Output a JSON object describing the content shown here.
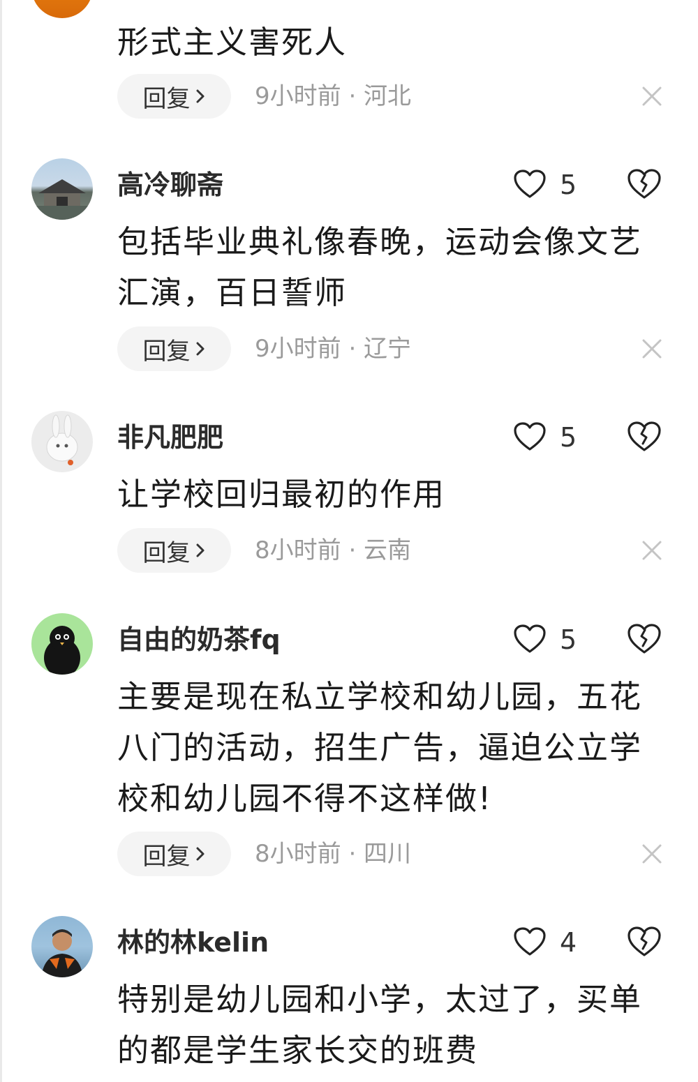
{
  "comments": [
    {
      "username": "",
      "likes": "",
      "text": "形式主义害死人",
      "reply_label": "回复",
      "time": "9小时前",
      "location": "河北",
      "meta": "9小时前 · 河北"
    },
    {
      "username": "高冷聊斋",
      "likes": "5",
      "text": "包括毕业典礼像春晚，运动会像文艺汇演，百日誓师",
      "reply_label": "回复",
      "time": "9小时前",
      "location": "辽宁",
      "meta": "9小时前 · 辽宁"
    },
    {
      "username": "非凡肥肥",
      "likes": "5",
      "text": "让学校回归最初的作用",
      "reply_label": "回复",
      "time": "8小时前",
      "location": "云南",
      "meta": "8小时前 · 云南"
    },
    {
      "username": "自由的奶茶fq",
      "likes": "5",
      "text": "主要是现在私立学校和幼儿园，五花八门的活动，招生广告，逼迫公立学校和幼儿园不得不这样做!",
      "reply_label": "回复",
      "time": "8小时前",
      "location": "四川",
      "meta": "8小时前 · 四川"
    },
    {
      "username": "林的林kelin",
      "likes": "4",
      "text": "特别是幼儿园和小学，太过了，买单的都是学生家长交的班费",
      "reply_label": "",
      "time": "",
      "location": "",
      "meta": ""
    }
  ],
  "icons": {
    "like": "heart-outline-icon",
    "dislike": "broken-heart-icon",
    "close": "close-icon",
    "chevron": "chevron-right-icon"
  },
  "colors": {
    "meta_text": "#9a9a9a",
    "reply_bg": "#f4f4f4",
    "icon_stroke": "#222222"
  }
}
